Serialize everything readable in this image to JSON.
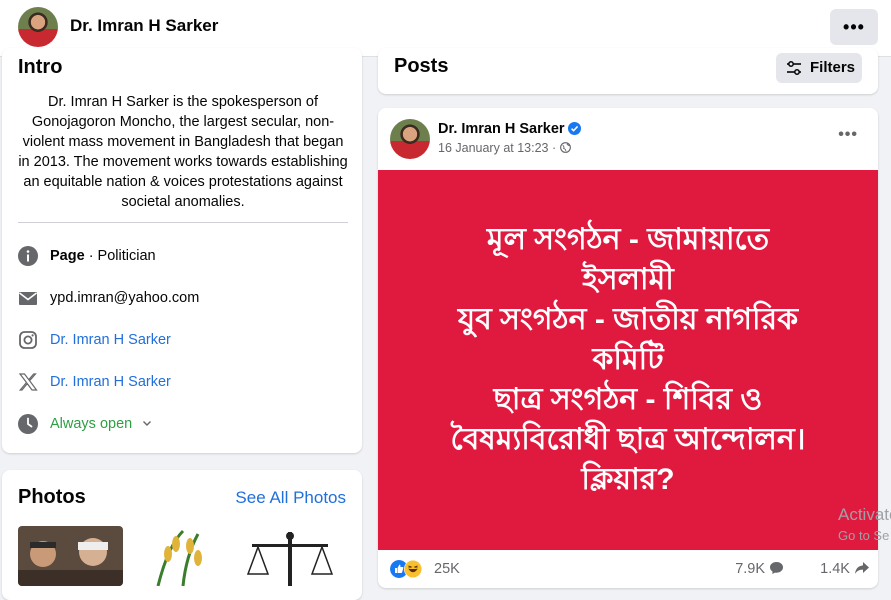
{
  "header": {
    "name": "Dr. Imran H Sarker",
    "more_label": "•••"
  },
  "intro": {
    "title": "Intro",
    "bio": "Dr. Imran H Sarker is the spokesperson of Gonojagoron Moncho, the largest secular, non-violent mass movement in Bangladesh that began in 2013. The movement works towards establishing an equitable nation & voices protestations against societal anomalies.",
    "category_bold": "Page",
    "category_rest": " · Politician",
    "email": "ypd.imran@yahoo.com",
    "instagram": "Dr. Imran H Sarker",
    "x_account": "Dr. Imran H Sarker",
    "hours": "Always open"
  },
  "photos": {
    "title": "Photos",
    "see_all": "See All Photos"
  },
  "posts": {
    "title": "Posts",
    "filters_label": "Filters"
  },
  "post": {
    "author": "Dr. Imran H Sarker",
    "date": "16 January at 13:23 · ",
    "more_label": "•••",
    "banner_lines": [
      "মূল সংগঠন - জামায়াতে",
      "ইসলামী",
      "যুব সংগঠন - জাতীয় নাগরিক",
      "কমিটি",
      "ছাত্র সংগঠন - শিবির ও",
      "বৈষম্যবিরোধী ছাত্র আন্দোলন।",
      "ক্লিয়ার?"
    ],
    "banner_color": "#e0193f",
    "reactions_count": "25K",
    "comments_count": "7.9K",
    "shares_count": "1.4K"
  },
  "watermark": {
    "line1": "Activate",
    "line2": "Go to Se"
  }
}
